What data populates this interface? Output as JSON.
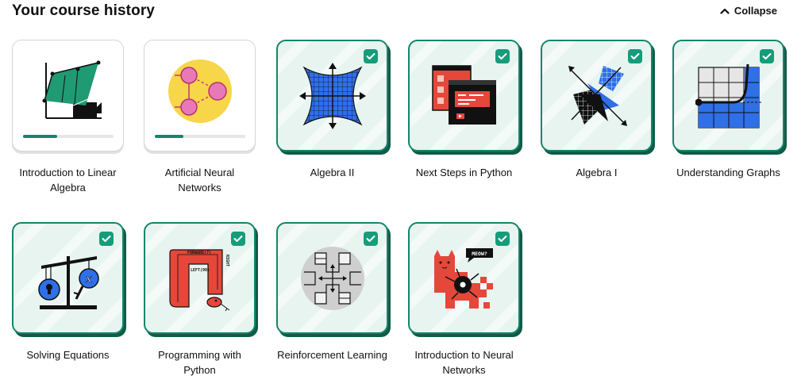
{
  "header": {
    "title": "Your course history",
    "collapse_label": "Collapse"
  },
  "courses": [
    {
      "title": "Introduction to Linear Algebra",
      "icon": "linear-algebra-icon",
      "completed": false,
      "progress": 0.38
    },
    {
      "title": "Artificial Neural Networks",
      "icon": "neural-network-icon",
      "completed": false,
      "progress": 0.32
    },
    {
      "title": "Algebra II",
      "icon": "algebra-ii-icon",
      "completed": true
    },
    {
      "title": "Next Steps in Python",
      "icon": "python-screens-icon",
      "completed": true
    },
    {
      "title": "Algebra I",
      "icon": "algebra-i-icon",
      "completed": true
    },
    {
      "title": "Understanding Graphs",
      "icon": "graph-curve-icon",
      "completed": true
    },
    {
      "title": "Solving Equations",
      "icon": "balance-scale-icon",
      "completed": true
    },
    {
      "title": "Programming with Python",
      "icon": "snake-path-icon",
      "completed": true,
      "art_text": [
        "FORWARD(7)",
        "LEFT(90)",
        "RIGHT"
      ]
    },
    {
      "title": "Reinforcement Learning",
      "icon": "maze-arrows-icon",
      "completed": true
    },
    {
      "title": "Introduction to Neural Networks",
      "icon": "cat-neuron-icon",
      "completed": true,
      "art_text": [
        "MEOW?"
      ]
    }
  ],
  "colors": {
    "brand_green": "#14866a",
    "check_green": "#169c7a",
    "tile_bg": "#e7f4ef",
    "blue": "#2f6fe8",
    "red": "#e5473a",
    "yellow": "#f7d64a",
    "pink": "#e879b8"
  }
}
